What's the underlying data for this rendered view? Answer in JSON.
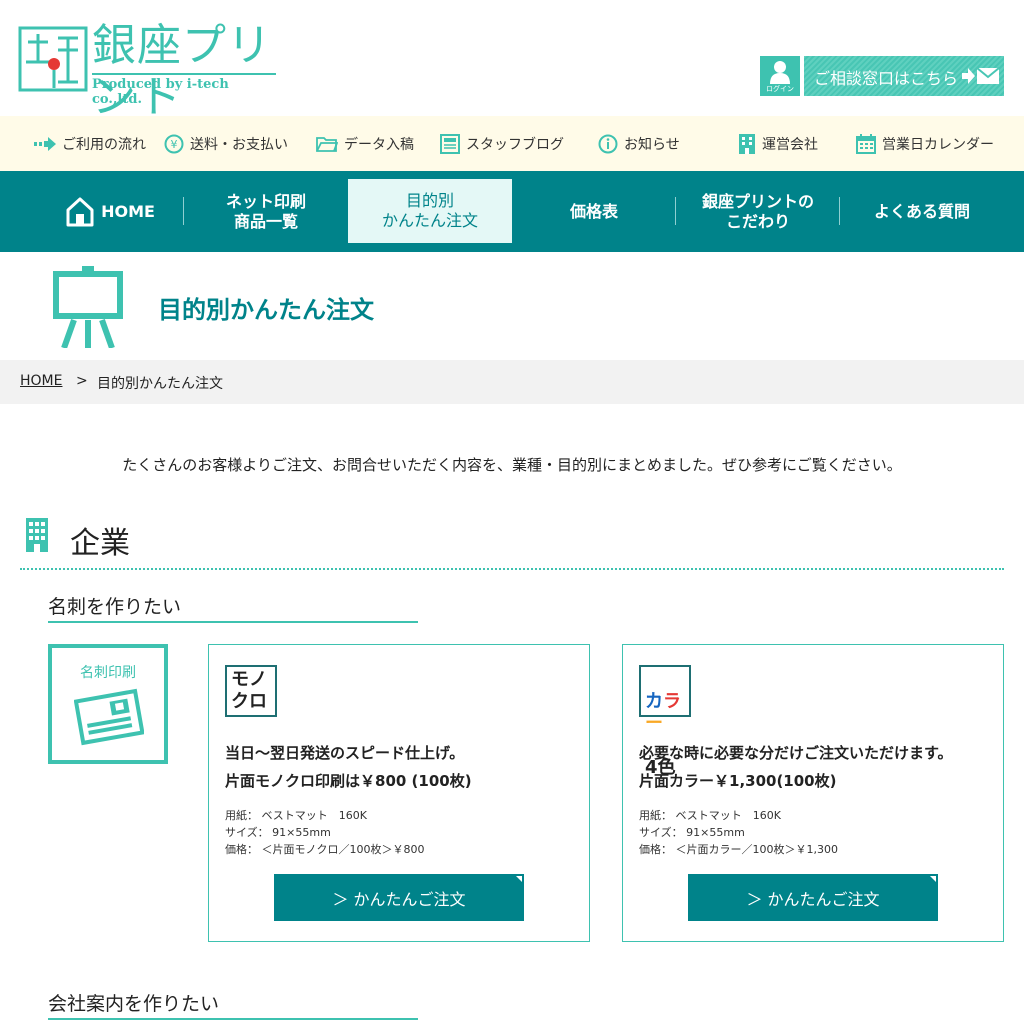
{
  "header": {
    "logo_text": "銀座プリント",
    "logo_sub": "Produced by i-tech co.,ltd.",
    "login_label": "ログイン",
    "consult_label": "ご相談窓口はこちら"
  },
  "subnav": {
    "items": [
      {
        "label": "ご利用の流れ",
        "icon": "arrow-right-icon"
      },
      {
        "label": "送料・お支払い",
        "icon": "yen-coin-icon"
      },
      {
        "label": "データ入稿",
        "icon": "folder-icon"
      },
      {
        "label": "スタッフブログ",
        "icon": "blog-icon"
      },
      {
        "label": "お知らせ",
        "icon": "info-icon"
      },
      {
        "label": "運営会社",
        "icon": "building-icon"
      },
      {
        "label": "営業日カレンダー",
        "icon": "calendar-icon"
      }
    ]
  },
  "gnav": {
    "items": [
      {
        "label": "HOME"
      },
      {
        "label": "ネット印刷\n商品一覧"
      },
      {
        "label": "目的別\nかんたん注文"
      },
      {
        "label": "価格表"
      },
      {
        "label": "銀座プリントの\nこだわり"
      },
      {
        "label": "よくある質問"
      }
    ],
    "active_index": 2
  },
  "page": {
    "title": "目的別かんたん注文",
    "breadcrumb_home": "HOME",
    "breadcrumb_sep": ">",
    "breadcrumb_current": "目的別かんたん注文",
    "intro": "たくさんのお客様よりご注文、お問合せいただく内容を、業種・目的別にまとめました。ぜひ参考にご覧ください。"
  },
  "section": {
    "title": "企業",
    "sub1": "名刺を作りたい",
    "category_label": "名刺印刷",
    "sub2": "会社案内を作りたい"
  },
  "products": [
    {
      "badge": "モノ\nクロ",
      "headline1": "当日～翌日発送のスピード仕上げ。",
      "headline2": "片面モノクロ印刷は￥800 (100枚)",
      "spec_paper": "用紙： ベストマット　160K",
      "spec_size": "サイズ： 91×55mm",
      "spec_price": "価格： ＜片面モノクロ／100枚＞￥800",
      "button": "＞ かんたんご注文"
    },
    {
      "badge": "カラー\n4色",
      "headline1": "必要な時に必要な分だけご注文いただけます。",
      "headline2": "片面カラー￥1,300(100枚)",
      "spec_paper": "用紙： ベストマット　160K",
      "spec_size": "サイズ： 91×55mm",
      "spec_price": "価格： ＜片面カラー／100枚＞￥1,300",
      "button": "＞ かんたんご注文"
    }
  ],
  "colors": {
    "accent": "#3ec2b0",
    "nav": "#00838a",
    "subnav_bg": "#fffbe8"
  }
}
